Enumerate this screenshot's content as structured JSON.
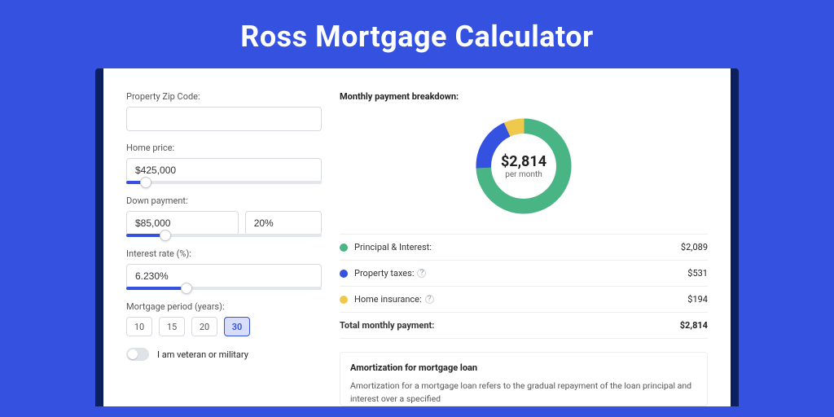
{
  "page_title": "Ross Mortgage Calculator",
  "form": {
    "zip_label": "Property Zip Code:",
    "zip_value": "",
    "home_price_label": "Home price:",
    "home_price_value": "$425,000",
    "down_payment_label": "Down payment:",
    "down_payment_value": "$85,000",
    "down_payment_pct": "20%",
    "interest_label": "Interest rate (%):",
    "interest_value": "6.230%",
    "period_label": "Mortgage period (years):",
    "periods": [
      "10",
      "15",
      "20",
      "30"
    ],
    "period_selected": "30",
    "veteran_label": "I am veteran or military"
  },
  "breakdown": {
    "title": "Monthly payment breakdown:",
    "center_amount": "$2,814",
    "center_sub": "per month",
    "rows": [
      {
        "label": "Principal & Interest:",
        "amount": "$2,089"
      },
      {
        "label": "Property taxes:",
        "amount": "$531"
      },
      {
        "label": "Home insurance:",
        "amount": "$194"
      }
    ],
    "total_label": "Total monthly payment:",
    "total_amount": "$2,814"
  },
  "amortization": {
    "title": "Amortization for mortgage loan",
    "text": "Amortization for a mortgage loan refers to the gradual repayment of the loan principal and interest over a specified"
  },
  "chart_data": {
    "type": "pie",
    "title": "Monthly payment breakdown",
    "series": [
      {
        "name": "Principal & Interest",
        "value": 2089,
        "color": "#4ab584"
      },
      {
        "name": "Property taxes",
        "value": 531,
        "color": "#3451e0"
      },
      {
        "name": "Home insurance",
        "value": 194,
        "color": "#efc94c"
      }
    ],
    "total": 2814,
    "units": "USD per month"
  }
}
